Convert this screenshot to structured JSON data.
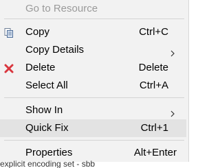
{
  "menu": {
    "go_to_resource": {
      "label": "Go to Resource"
    },
    "copy": {
      "label": "Copy",
      "shortcut": "Ctrl+C",
      "icon": "copy-icon"
    },
    "copy_details": {
      "label": "Copy Details",
      "icon": "chevron-right-icon"
    },
    "delete": {
      "label": "Delete",
      "shortcut": "Delete",
      "icon": "delete-x-icon"
    },
    "select_all": {
      "label": "Select All",
      "shortcut": "Ctrl+A"
    },
    "show_in": {
      "label": "Show In",
      "icon": "chevron-right-icon"
    },
    "quick_fix": {
      "label": "Quick Fix",
      "shortcut": "Ctrl+1"
    },
    "properties": {
      "label": "Properties",
      "shortcut": "Alt+Enter"
    }
  },
  "background": {
    "text": "explicit encoding set - sbb"
  },
  "colors": {
    "menu_bg": "#f2f2f2",
    "highlight": "#e3e3e3",
    "delete_red": "#d9363e",
    "disabled_text": "#9a9a9a"
  }
}
